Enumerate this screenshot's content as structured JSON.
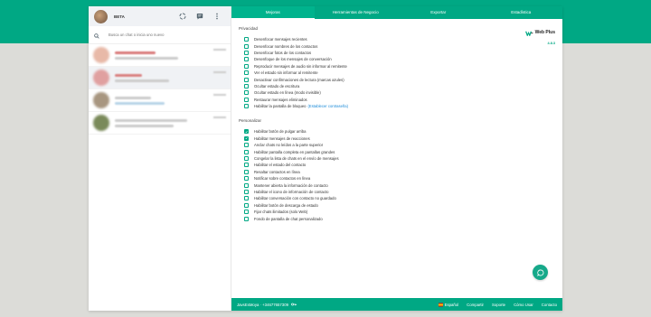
{
  "colors": {
    "brand": "#00a884",
    "link": "#1a8ad8"
  },
  "sidebar": {
    "profile_name": "BETA",
    "search_placeholder": "Busca un chat o inicia uno nuevo"
  },
  "tabs": [
    "Mejoras",
    "Herramientas de Negocio",
    "Exportar",
    "Estadística"
  ],
  "logo": {
    "name": "Web Plus",
    "version": "4.8.3"
  },
  "privacidad": {
    "title": "Privacidad",
    "options": [
      {
        "label": "Desenfocar mensajes recientes",
        "checked": false
      },
      {
        "label": "Desenfocar nombres de los contactos",
        "checked": false
      },
      {
        "label": "Desenfocar fotos de los contactos",
        "checked": false
      },
      {
        "label": "Desenfoque de los mensajes de conversación",
        "checked": false
      },
      {
        "label": "Reproducir mensajes de audio sin informar al remitente",
        "checked": false
      },
      {
        "label": "Ver el estado sin informar al remitente",
        "checked": false
      },
      {
        "label": "Desactivar confirmaciones de lectura (marcas azules)",
        "checked": false
      },
      {
        "label": "Ocultar estado de escritura",
        "checked": false
      },
      {
        "label": "Ocultar estado en línea (modo invisible)",
        "checked": false
      },
      {
        "label": "Restaurar mensajes eliminados",
        "checked": false
      },
      {
        "label": "Habilitar la pantalla de bloqueo",
        "checked": false,
        "link": "(Establecer contraseña)"
      }
    ]
  },
  "personalizar": {
    "title": "Personalizar",
    "options": [
      {
        "label": "Habilitar botón de pulgar arriba",
        "checked": true
      },
      {
        "label": "Habilitar mensajes de reacciones",
        "checked": true
      },
      {
        "label": "Anclar chats no leídos a la parte superior",
        "checked": false
      },
      {
        "label": "Habilitar pantalla completa en pantallas grandes",
        "checked": false
      },
      {
        "label": "Congelar la lista de chats en el envío de mensajes",
        "checked": false
      },
      {
        "label": "Habilitar el estado del contacto",
        "checked": false
      },
      {
        "label": "Resaltar contactos en línea",
        "checked": false
      },
      {
        "label": "Notificar sobre contactos en línea",
        "checked": false
      },
      {
        "label": "Mantener abierta la información de contacto",
        "checked": false
      },
      {
        "label": "Habilitar el icono de información de contacto",
        "checked": false
      },
      {
        "label": "Habilitar conversación con contacto no guardado",
        "checked": false
      },
      {
        "label": "Habilitar botón de descarga de estado",
        "checked": false
      },
      {
        "label": "Fijar chats ilimitados (solo Web)",
        "checked": false
      },
      {
        "label": "Fondo de pantalla de chat personalizado",
        "checked": false
      }
    ]
  },
  "footer": {
    "user": "JavsEsMoya · +34677657309",
    "language": "Español",
    "links": [
      "Compartir",
      "Soporte",
      "Cómo Usar",
      "Contacto"
    ]
  }
}
